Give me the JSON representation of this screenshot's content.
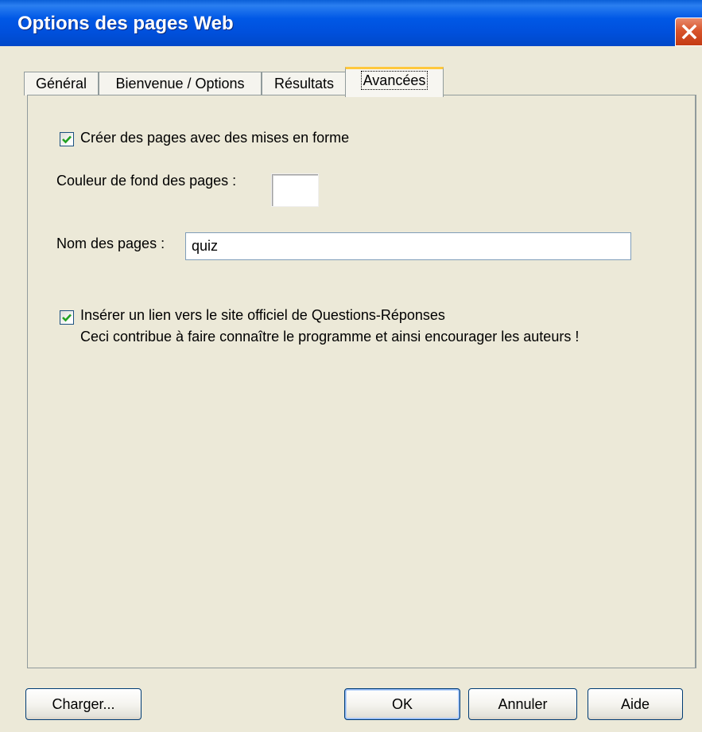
{
  "window": {
    "title": "Options des pages Web"
  },
  "tabs": [
    {
      "label": "Général",
      "active": false
    },
    {
      "label": "Bienvenue / Options",
      "active": false
    },
    {
      "label": "Résultats",
      "active": false
    },
    {
      "label": "Avancées",
      "active": true
    }
  ],
  "advanced": {
    "formatted_pages": {
      "label": "Créer des pages avec des mises en forme",
      "checked": true
    },
    "background_color": {
      "label": "Couleur de fond des pages :",
      "value": "#ffffff"
    },
    "page_name": {
      "label": "Nom des pages :",
      "value": "quiz"
    },
    "official_link": {
      "label": "Insérer un lien vers le site officiel de Questions-Réponses",
      "note": "Ceci contribue à faire connaître le programme et ainsi encourager les auteurs !",
      "checked": true
    }
  },
  "buttons": {
    "load": "Charger...",
    "ok": "OK",
    "cancel": "Annuler",
    "help": "Aide"
  },
  "colors": {
    "titlebar": "#0054e3",
    "close_button": "#d8552c",
    "dialog_background": "#ece9d8",
    "active_tab_highlight": "#ffc83c",
    "checkmark": "#21a121"
  },
  "icons": {
    "close": "close-icon",
    "check": "checkmark-icon"
  }
}
